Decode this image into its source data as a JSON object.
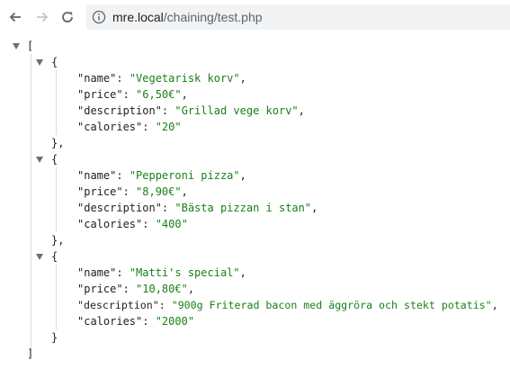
{
  "browser": {
    "url_host": "mre.local",
    "url_path": "/chaining/test.php"
  },
  "json": {
    "open_bracket": "[",
    "close_bracket": "]",
    "items": [
      {
        "open": "{",
        "close": "},",
        "lines": [
          {
            "key": "\"name\"",
            "value": "\"Vegetarisk korv\"",
            "end": ","
          },
          {
            "key": "\"price\"",
            "value": "\"6,50€\"",
            "end": ","
          },
          {
            "key": "\"description\"",
            "value": "\"Grillad vege korv\"",
            "end": ","
          },
          {
            "key": "\"calories\"",
            "value": "\"20\"",
            "end": ""
          }
        ]
      },
      {
        "open": "{",
        "close": "},",
        "lines": [
          {
            "key": "\"name\"",
            "value": "\"Pepperoni pizza\"",
            "end": ","
          },
          {
            "key": "\"price\"",
            "value": "\"8,90€\"",
            "end": ","
          },
          {
            "key": "\"description\"",
            "value": "\"Bästa pizzan i stan\"",
            "end": ","
          },
          {
            "key": "\"calories\"",
            "value": "\"400\"",
            "end": ""
          }
        ]
      },
      {
        "open": "{",
        "close": "}",
        "lines": [
          {
            "key": "\"name\"",
            "value": "\"Matti's special\"",
            "end": ","
          },
          {
            "key": "\"price\"",
            "value": "\"10,80€\"",
            "end": ","
          },
          {
            "key": "\"description\"",
            "value": "\"900g Friterad bacon med äggröra och stekt potatis\"",
            "end": ","
          },
          {
            "key": "\"calories\"",
            "value": "\"2000\"",
            "end": ""
          }
        ]
      }
    ]
  },
  "colors": {
    "string": "#1a7f1a",
    "key": "#222222",
    "toggle": "#6e6e6e"
  },
  "icons": [
    "back-arrow-icon",
    "forward-arrow-icon",
    "reload-icon",
    "info-icon",
    "collapse-triangle-icon"
  ]
}
